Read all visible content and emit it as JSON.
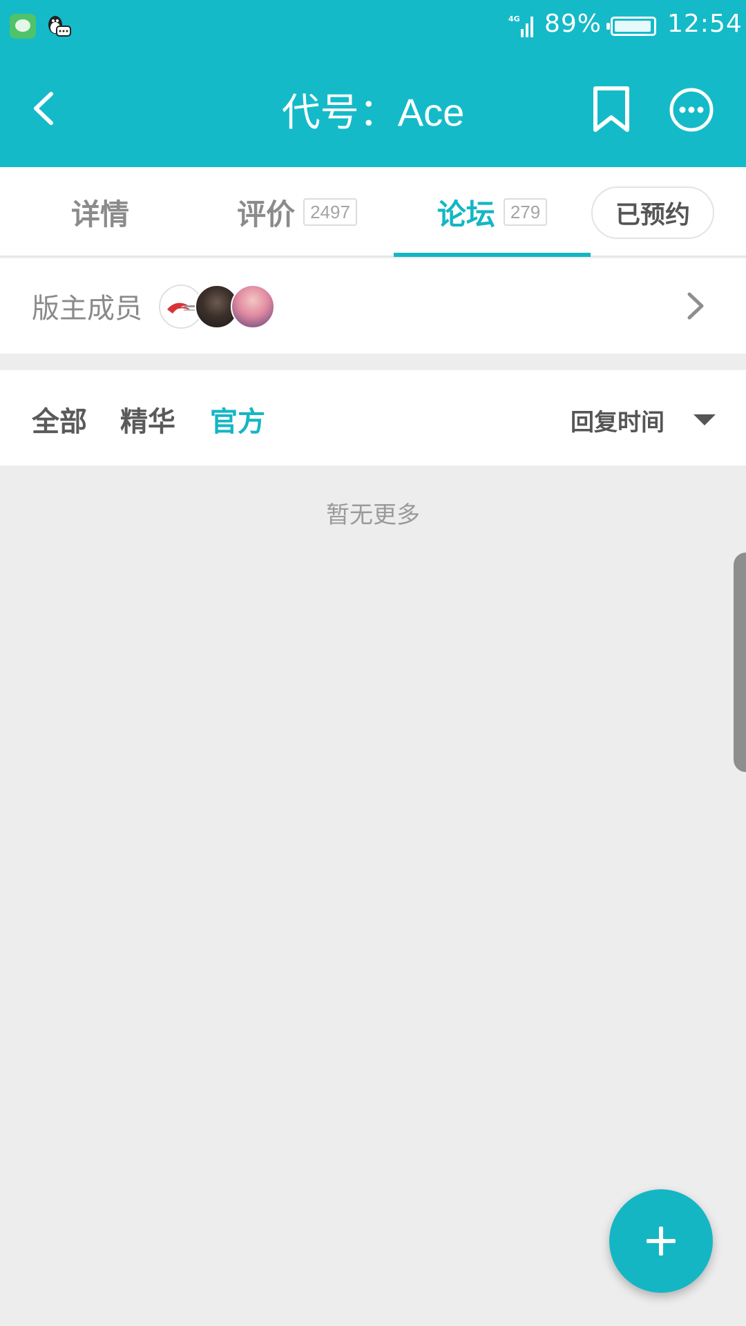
{
  "status_bar": {
    "network": "4G",
    "battery": "89%",
    "time": "12:54",
    "icons": [
      "wechat-icon",
      "qq-icon",
      "signal-icon",
      "battery-icon"
    ]
  },
  "header": {
    "title": "代号：Ace",
    "icons": [
      "back-arrow-icon",
      "bookmark-icon",
      "more-icon"
    ],
    "background": "#15bac8"
  },
  "tabs": {
    "details": {
      "label": "详情"
    },
    "reviews": {
      "label": "评价",
      "count": "2497"
    },
    "forum": {
      "label": "论坛",
      "count": "279",
      "active": true
    },
    "reserved_label": "已预约"
  },
  "moderators": {
    "label": "版主成员",
    "avatar_count": 3
  },
  "filters": {
    "all": "全部",
    "featured": "精华",
    "official": "官方",
    "active": "官方",
    "sort_label": "回复时间"
  },
  "content": {
    "empty_text": "暂无更多"
  },
  "colors": {
    "accent": "#15b6c4",
    "page_background": "#ededee"
  }
}
